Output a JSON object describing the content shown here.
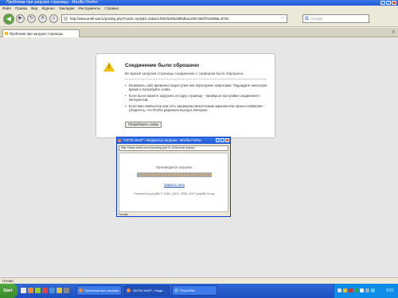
{
  "browser": {
    "title": "Проблема при загрузке страницы - Mozilla Firefox",
    "menu": [
      "Файл",
      "Правка",
      "Вид",
      "Журнал",
      "Закладки",
      "Инструменты",
      "Справка"
    ],
    "url": "http://www.antik-war.lv/posting.php?mode=reply&f=41&sid=f054f1085af3fbdbac2057286f7b1999&t=8753",
    "search_placeholder": "Google",
    "tab_label": "Проблема при загрузке страницы",
    "status": "Готово"
  },
  "error": {
    "title": "Соединение было сброшено",
    "description": "Во время загрузки страницы соединение с сервером было сброшено.",
    "bullets": [
      "Возможно, сайт временно недоступен или перегружен запросами. Подождите некоторое время и попробуйте снова.",
      "Если вы не можете загрузить ни одну страницу – проверьте настройки соединения с Интернетом.",
      "Если ваш компьютер или сеть защищены межсетевым экраном или прокси-сервером – убедитесь, что Firefox разрешён выход в Интернет."
    ],
    "retry_label": "Попробовать снова"
  },
  "popup": {
    "title": "\"ANTIK-WAR\" • Индикатор загрузки - Mozilla Firefox",
    "url": "http://www.antik-war.lv/posting.php?f=41&mode=popup",
    "progress_text": "Производится загрузка.",
    "close_label": "Закрыть окно",
    "powered": "Powered by phpBB © 2000, 2002, 2005, 2007 phpBB Group",
    "status": "Готово"
  },
  "taskbar": {
    "start_label": "Start",
    "items": [
      "Проблема при загрузке...",
      "\"ANTIK-WAR\" • Инди...",
      "PhotoFiltre"
    ],
    "clock": "0:51"
  },
  "colors": {
    "xp_title": "#1f57d6",
    "start_green": "#3a8a2b",
    "warning_yellow": "#f2c200",
    "link_blue": "#1a4fa8"
  }
}
